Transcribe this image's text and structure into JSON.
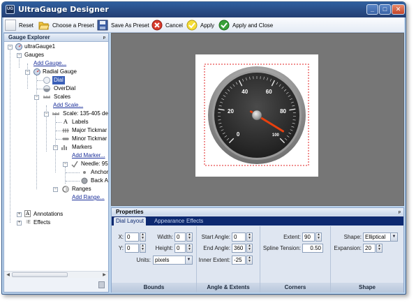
{
  "window": {
    "title": "UltraGauge Designer",
    "minimize": "_",
    "maximize": "□",
    "close": "✕",
    "app_icon_text": "UG"
  },
  "toolbar": {
    "reset": "Reset",
    "choose_preset": "Choose a Preset",
    "save_preset": "Save As Preset",
    "cancel": "Cancel",
    "apply": "Apply",
    "apply_close": "Apply and Close"
  },
  "explorer": {
    "title": "Gauge Explorer",
    "pin": "ᵖ",
    "nodes": {
      "root": "ultraGauge1",
      "gauges": "Gauges",
      "add_gauge": "Add Gauge...",
      "radial_gauge": "Radial Gauge",
      "dial": "Dial",
      "overdial": "OverDial",
      "scales": "Scales",
      "add_scale": "Add Scale...",
      "scale": "Scale: 135-405 de",
      "labels": "Labels",
      "major_tick": "Major Tickmar",
      "minor_tick": "Minor Tickmar",
      "markers": "Markers",
      "add_marker": "Add Marker...",
      "needle": "Needle: 95",
      "anchor": "Anchor",
      "back": "Back A",
      "ranges": "Ranges",
      "add_range": "Add Range...",
      "annotations": "Annotations",
      "effects": "Effects"
    }
  },
  "gauge": {
    "labels": [
      "0",
      "20",
      "40",
      "60",
      "80",
      "100"
    ],
    "needle_value": 95,
    "min": 0,
    "max": 100,
    "start_angle": 135,
    "end_angle": 405
  },
  "properties": {
    "title": "Properties",
    "pin": "ᵖ",
    "tabs": [
      "Dial Layout",
      "Appearance",
      "Effects"
    ],
    "bounds": {
      "header": "Bounds",
      "x_label": "X:",
      "x_value": "0",
      "y_label": "Y:",
      "y_value": "0",
      "width_label": "Width:",
      "width_value": "0",
      "height_label": "Height:",
      "height_value": "0",
      "units_label": "Units:",
      "units_value": "pixels"
    },
    "angle": {
      "header": "Angle & Extents",
      "start_label": "Start Angle:",
      "start_value": "0",
      "end_label": "End Angle:",
      "end_value": "360",
      "inner_label": "Inner Extent:",
      "inner_value": "-25"
    },
    "corners": {
      "header": "Corners",
      "extent_label": "Extent:",
      "extent_value": "90",
      "spline_label": "Spline Tension:",
      "spline_value": "0.50"
    },
    "shape": {
      "header": "Shape",
      "shape_label": "Shape:",
      "shape_value": "Elliptical",
      "expansion_label": "Expansion:",
      "expansion_value": "20"
    }
  }
}
